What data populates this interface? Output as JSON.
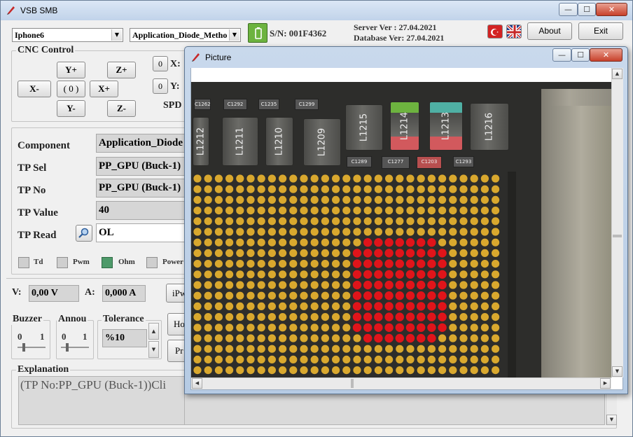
{
  "app": {
    "title": "VSB SMB"
  },
  "titlebar": {
    "minimize": "—",
    "maximize": "☐",
    "close": "✕"
  },
  "top": {
    "device": "Iphone6",
    "method": "Application_Diode_Metho",
    "serial": "S/N: 001F4362",
    "server_ver": "Server Ver   : 27.04.2021",
    "database_ver": "Database Ver: 27.04.2021",
    "about": "About",
    "exit": "Exit"
  },
  "cnc": {
    "legend": "CNC Control",
    "y_plus": "Y+",
    "z_plus": "Z+",
    "x_minus": "X-",
    "home": "( 0 )",
    "x_plus": "X+",
    "y_minus": "Y-",
    "z_minus": "Z-",
    "zero_x": "0",
    "zero_y": "0",
    "x_label": "X:",
    "y_label": "Y:",
    "spd_label": "SPD"
  },
  "component": {
    "component_label": "Component",
    "component_value": "Application_Diode",
    "tp_sel_label": "TP Sel",
    "tp_sel_value": "PP_GPU  (Buck-1)",
    "tp_no_label": "TP No",
    "tp_no_value": "PP_GPU  (Buck-1)",
    "tp_value_label": "TP Value",
    "tp_value_value": "40",
    "tp_read_label": "TP Read",
    "tp_read_value": "OL"
  },
  "modes": [
    {
      "label": "Td",
      "active": false
    },
    {
      "label": "Pwm",
      "active": false
    },
    {
      "label": "Ohm",
      "active": true
    },
    {
      "label": "Power",
      "active": false
    }
  ],
  "meter": {
    "v_label": "V:",
    "v_value": "0,00 V",
    "a_label": "A:",
    "a_value": "0,000 A",
    "ipw_label": "iPw"
  },
  "buzzer": {
    "legend": "Buzzer",
    "min": "0",
    "max": "1"
  },
  "annou": {
    "legend": "Annou",
    "min": "0",
    "max": "1"
  },
  "tolerance": {
    "legend": "Tolerance",
    "value": "%10"
  },
  "side_buttons": {
    "ho": "Ho",
    "pr": "Pr"
  },
  "explanation": {
    "legend": "Explanation",
    "text": "(TP No:PP_GPU  (Buck-1))Cli"
  },
  "picture": {
    "title": "Picture",
    "components": [
      "L1212",
      "L1211",
      "L1210",
      "L1209",
      "L1215",
      "L1214",
      "L1213",
      "L1216"
    ],
    "small_parts": [
      "C1262",
      "C1292",
      "C1235",
      "C1299",
      "C1289",
      "C1277",
      "C1203",
      "C1293"
    ]
  },
  "colors": {
    "accent_green": "#6db33f",
    "highlight_red": "#e0141a",
    "board_gold": "#d9a82e",
    "flag_red": "#d32323"
  }
}
